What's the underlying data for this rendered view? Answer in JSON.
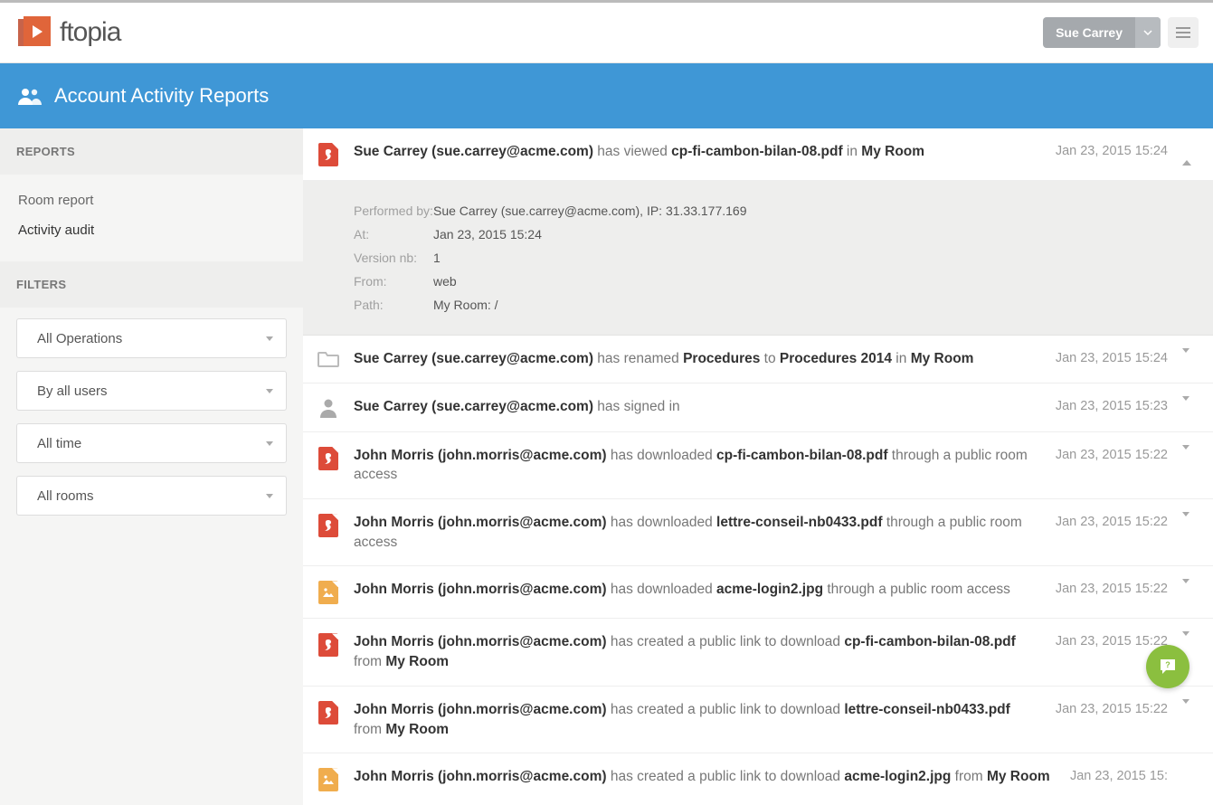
{
  "brand": {
    "name": "ftopia"
  },
  "header": {
    "user_name": "Sue Carrey"
  },
  "banner": {
    "title": "Account Activity Reports"
  },
  "sidebar": {
    "reports_header": "REPORTS",
    "filters_header": "FILTERS",
    "links": [
      {
        "label": "Room report",
        "name": "room-report",
        "active": false
      },
      {
        "label": "Activity audit",
        "name": "activity-audit",
        "active": true
      }
    ],
    "filters": [
      {
        "label": "All Operations",
        "name": "filter-operations"
      },
      {
        "label": "By all users",
        "name": "filter-users"
      },
      {
        "label": "All time",
        "name": "filter-time"
      },
      {
        "label": "All rooms",
        "name": "filter-rooms"
      }
    ]
  },
  "activity": [
    {
      "icon": "pdf",
      "user": "Sue Carrey (sue.carrey@acme.com)",
      "mid1": " has viewed ",
      "obj1": "cp-fi-cambon-bilan-08.pdf",
      "mid2": " in ",
      "obj2": "My Room",
      "tail": "",
      "time": "Jan 23, 2015 15:24",
      "expanded": true,
      "details": {
        "performed_by_label": "Performed by:",
        "performed_by": "Sue Carrey (sue.carrey@acme.com), IP: 31.33.177.169",
        "at_label": "At:",
        "at": "Jan 23, 2015 15:24",
        "version_label": "Version nb:",
        "version": "1",
        "from_label": "From:",
        "from": "web",
        "path_label": "Path:",
        "path": "My Room: /"
      }
    },
    {
      "icon": "folder",
      "user": "Sue Carrey (sue.carrey@acme.com)",
      "mid1": " has renamed ",
      "obj1": "Procedures",
      "mid2": " to ",
      "obj2": "Procedures 2014",
      "mid3": " in ",
      "obj3": "My Room",
      "tail": "",
      "time": "Jan 23, 2015 15:24"
    },
    {
      "icon": "person",
      "user": "Sue Carrey (sue.carrey@acme.com)",
      "mid1": " has signed in",
      "obj1": "",
      "mid2": "",
      "obj2": "",
      "tail": "",
      "time": "Jan 23, 2015 15:23"
    },
    {
      "icon": "pdf",
      "user": "John Morris (john.morris@acme.com)",
      "mid1": " has downloaded ",
      "obj1": "cp-fi-cambon-bilan-08.pdf",
      "mid2": "",
      "obj2": "",
      "tail": " through a public room access",
      "time": "Jan 23, 2015 15:22"
    },
    {
      "icon": "pdf",
      "user": "John Morris (john.morris@acme.com)",
      "mid1": " has downloaded ",
      "obj1": "lettre-conseil-nb0433.pdf",
      "mid2": "",
      "obj2": "",
      "tail": " through a public room access",
      "time": "Jan 23, 2015 15:22"
    },
    {
      "icon": "img",
      "user": "John Morris (john.morris@acme.com)",
      "mid1": " has downloaded ",
      "obj1": "acme-login2.jpg",
      "mid2": "",
      "obj2": "",
      "tail": " through a public room access",
      "time": "Jan 23, 2015 15:22"
    },
    {
      "icon": "pdf",
      "user": "John Morris (john.morris@acme.com)",
      "mid1": " has created a public link to download ",
      "obj1": "cp-fi-cambon-bilan-08.pdf",
      "mid2": " from ",
      "obj2": "My Room",
      "tail": "",
      "time": "Jan 23, 2015 15:22"
    },
    {
      "icon": "pdf",
      "user": "John Morris (john.morris@acme.com)",
      "mid1": " has created a public link to download ",
      "obj1": "lettre-conseil-nb0433.pdf",
      "mid2": " from ",
      "obj2": "My Room",
      "tail": "",
      "time": "Jan 23, 2015 15:22"
    },
    {
      "icon": "img",
      "user": "John Morris (john.morris@acme.com)",
      "mid1": " has created a public link to download ",
      "obj1": "acme-login2.jpg",
      "mid2": " from ",
      "obj2": "My Room",
      "tail": "",
      "time": "Jan 23, 2015 15:"
    }
  ]
}
